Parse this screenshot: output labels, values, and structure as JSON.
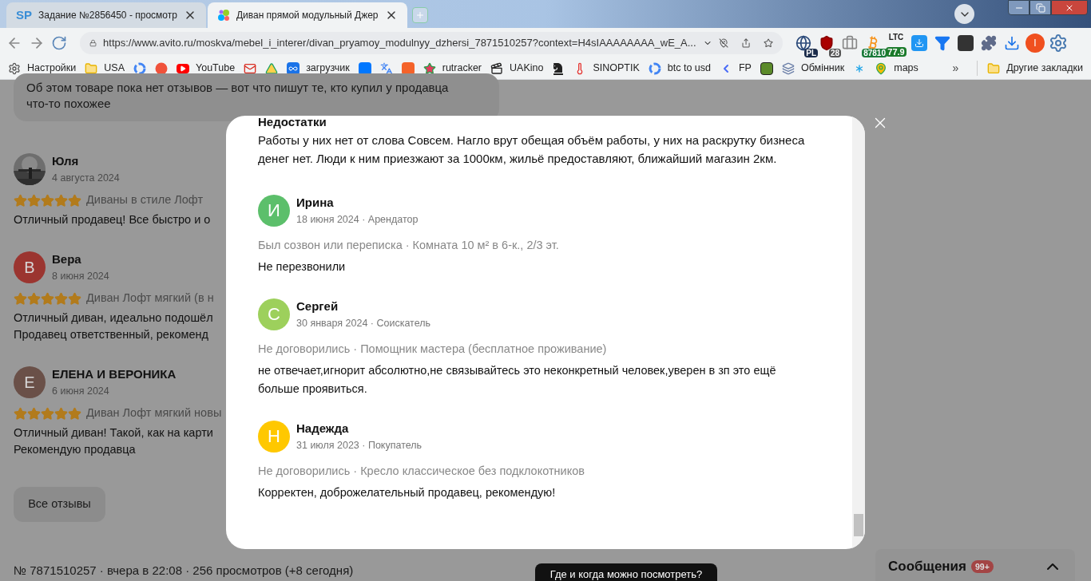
{
  "browser": {
    "tabs": [
      {
        "title": "Задание №2856450 - просмотр",
        "favicon": "SP",
        "selected": false
      },
      {
        "title": "Диван прямой модульный Джер",
        "selected": true
      }
    ],
    "url": "https://www.avito.ru/moskva/mebel_i_interer/divan_pryamoy_modulnyy_dzhersi_7871510257?context=H4sIAAAAAAAA_wE_A...",
    "extensions": [
      {
        "kind": "globe",
        "badge": "PL"
      },
      {
        "kind": "shield",
        "badge": "28"
      },
      {
        "kind": "case"
      },
      {
        "kind": "coin",
        "badge": "87810"
      },
      {
        "kind": "ticker",
        "top": "LTC",
        "badge": "77.9"
      },
      {
        "kind": "download-box"
      },
      {
        "kind": "funnel"
      },
      {
        "kind": "dark-box"
      },
      {
        "kind": "puzzle"
      },
      {
        "kind": "download"
      },
      {
        "kind": "avatar",
        "letter": "I"
      },
      {
        "kind": "gear"
      }
    ],
    "bookmarks": [
      {
        "kind": "gear",
        "label": "Настройки"
      },
      {
        "kind": "folder",
        "label": "USA"
      },
      {
        "kind": "google"
      },
      {
        "kind": "yandex"
      },
      {
        "kind": "youtube",
        "label": "YouTube"
      },
      {
        "kind": "mail"
      },
      {
        "kind": "drive"
      },
      {
        "kind": "infinity",
        "label": "загрузчик"
      },
      {
        "kind": "vk"
      },
      {
        "kind": "translate"
      },
      {
        "kind": "fbox"
      },
      {
        "kind": "star",
        "label": "rutracker"
      },
      {
        "kind": "film",
        "label": "UAKino"
      },
      {
        "kind": "chess"
      },
      {
        "kind": "thermo",
        "label": "SINOPTIK"
      },
      {
        "kind": "google",
        "label": "btc to usd"
      },
      {
        "kind": "chevron",
        "label": "FP"
      },
      {
        "kind": "bcbox"
      },
      {
        "kind": "layers",
        "label": "Обмінник"
      },
      {
        "kind": "asterisk"
      },
      {
        "kind": "pin",
        "label": "maps"
      }
    ],
    "more": "»",
    "other_bookmarks": "Другие закладки"
  },
  "page": {
    "notice": "Об этом товаре пока нет отзывов — вот что пишут те, кто купил у продавца что-то похожее",
    "reviews": [
      {
        "name": "Юля",
        "date": "4 августа 2024",
        "avatar": {
          "kind": "picture"
        },
        "stars": 5,
        "product": "Диваны в стиле Лофт",
        "text": [
          "Отличный продавец! Все быстро и о"
        ]
      },
      {
        "name": "Вера",
        "date": "8 июня 2024",
        "avatar": {
          "kind": "letter",
          "letter": "В",
          "color": "#9b3530"
        },
        "stars": 5,
        "product": "Диван Лофт мягкий (в н",
        "text": [
          "Отличный диван, идеально подошёл",
          "Продавец ответственный, рекоменд"
        ]
      },
      {
        "name": "ЕЛЕНА И ВЕРОНИКА",
        "date": "6 июня 2024",
        "avatar": {
          "kind": "letter",
          "letter": "Е",
          "color": "#6a5048"
        },
        "stars": 5,
        "product": "Диван Лофт мягкий новы",
        "text": [
          "Отличный диван! Такой, как на карти",
          "Рекомендую продавца"
        ]
      }
    ],
    "all_reviews": "Все отзывы",
    "footer": "№ 7871510257 · вчера в 22:08 · 256 просмотров (+8 сегодня)",
    "view_button": "Где и когда можно посмотреть?",
    "messages": {
      "label": "Сообщения",
      "badge": "99+"
    }
  },
  "modal": {
    "section_title": "Недостатки",
    "section_text": "Работы у них нет от слова Совсем. Нагло врут обещая объём работы, у них на раскрутку бизнеса денег нет. Люди к ним приезжают за 1000км, жильё предоставляют, ближайший магазин 2км.",
    "reviews": [
      {
        "name": "Ирина",
        "letter": "И",
        "color": "#5cbf6b",
        "date": "18 июня 2024 · Арендатор",
        "meta": "Был созвон или переписка · Комната 10 м² в 6-к., 2/3 эт.",
        "text": "Не перезвонили"
      },
      {
        "name": "Сергей",
        "letter": "С",
        "color": "#9dd05c",
        "date": "30 января 2024 · Соискатель",
        "meta": "Не договорились · Помощник мастера (бесплатное проживание)",
        "text": "не отвечает,игнорит абсолютно,не связывайтесь это неконкретный человек,уверен в зп это ещё больше проявиться."
      },
      {
        "name": "Надежда",
        "letter": "Н",
        "color": "#ffc800",
        "date": "31 июля 2023 · Покупатель",
        "meta": "Не договорились · Кресло классическое без подклокотников",
        "text": "Корректен, доброжелательный продавец, рекомендую!"
      }
    ]
  }
}
